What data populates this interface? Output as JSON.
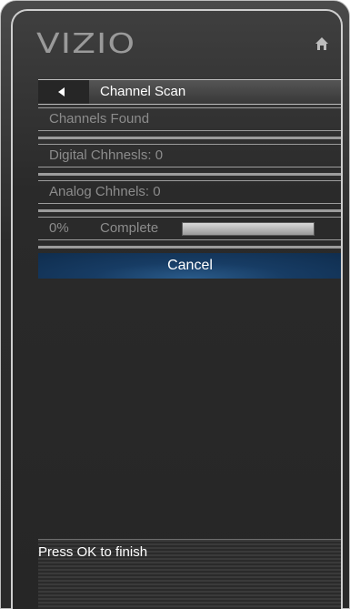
{
  "header": {
    "logo": "VIZIO",
    "home_icon": "home-icon"
  },
  "breadcrumb": {
    "back_icon": "back-arrow-icon",
    "title": "Channel Scan"
  },
  "rows": [
    {
      "label": "Channels Found"
    },
    {
      "label": "Digital Chhnesls: 0"
    },
    {
      "label": "Analog Chhnels: 0"
    }
  ],
  "progress": {
    "percent_text": "0%",
    "label": "Complete",
    "value": 0
  },
  "actions": {
    "cancel_label": "Cancel"
  },
  "footer": {
    "hint": "Press OK to finish"
  },
  "colors": {
    "accent_blue": "#173c64",
    "text_gray": "#8c8c8c",
    "line_gray": "#9c9c9c"
  }
}
